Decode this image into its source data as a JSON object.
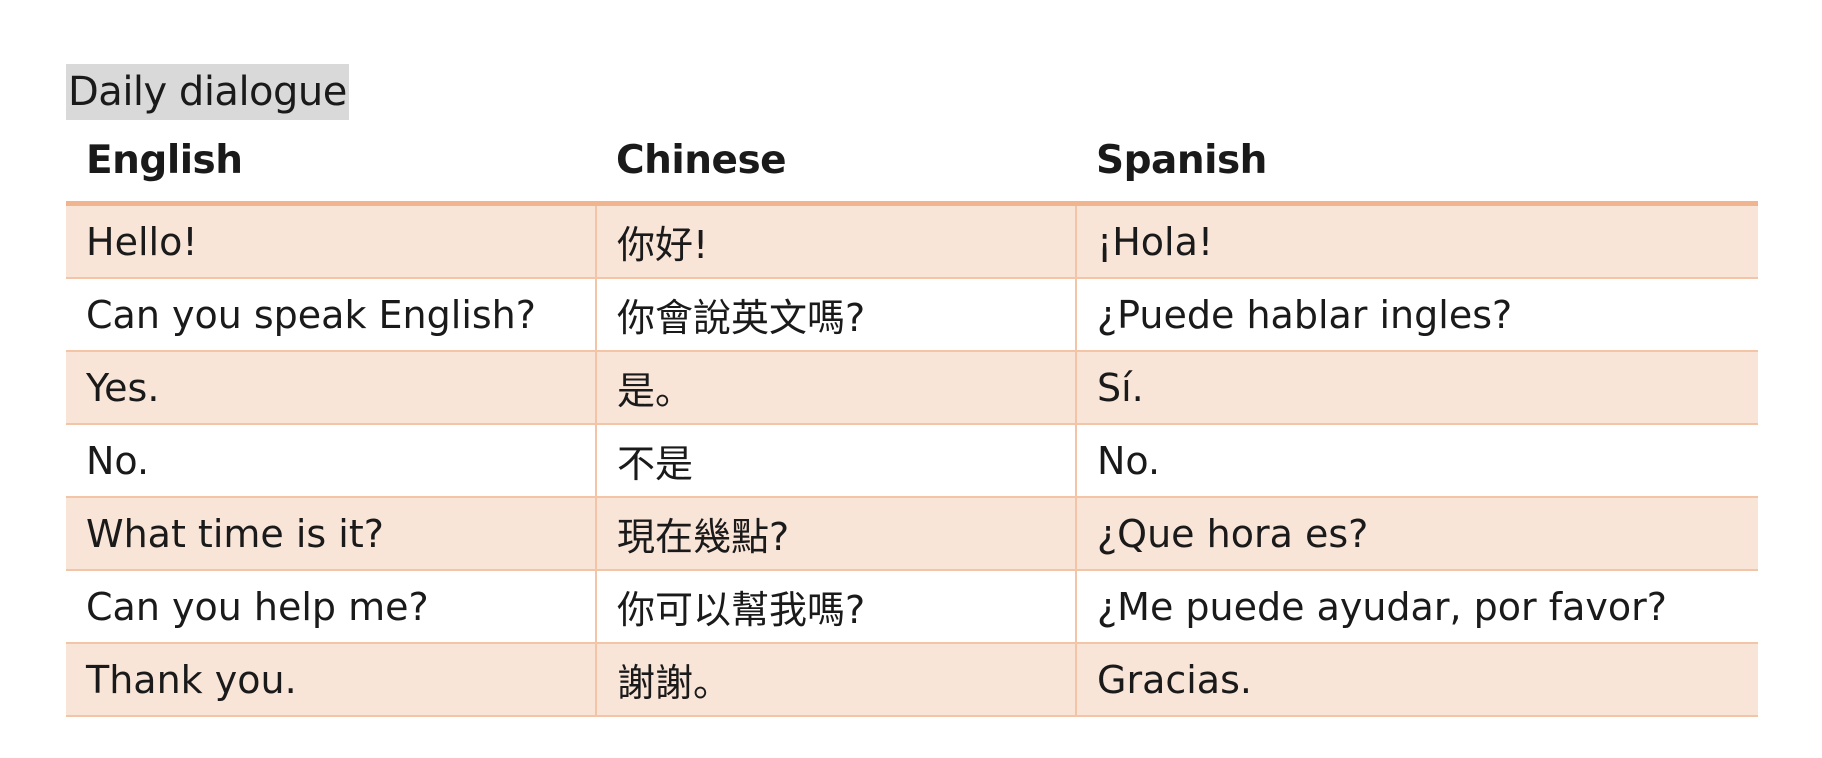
{
  "caption": "Daily dialogue",
  "table": {
    "headers": [
      "English",
      "Chinese",
      "Spanish"
    ],
    "rows": [
      [
        "Hello!",
        "你好!",
        "¡Hola!"
      ],
      [
        "Can you speak English?",
        "你會說英文嗎?",
        "¿Puede hablar ingles?"
      ],
      [
        "Yes.",
        "是。",
        "Sí."
      ],
      [
        "No.",
        "不是",
        "No."
      ],
      [
        "What time is it?",
        "現在幾點?",
        "¿Que hora es?"
      ],
      [
        "Can you help me?",
        "你可以幫我嗎?",
        "¿Me puede ayudar, por favor?"
      ],
      [
        "Thank you.",
        "謝謝。",
        "Gracias."
      ]
    ]
  },
  "colors": {
    "caption_highlight": "#d9d9d9",
    "header_rule": "#f0b48e",
    "row_border": "#f3c4a6",
    "band_fill": "#f9e4d8"
  }
}
